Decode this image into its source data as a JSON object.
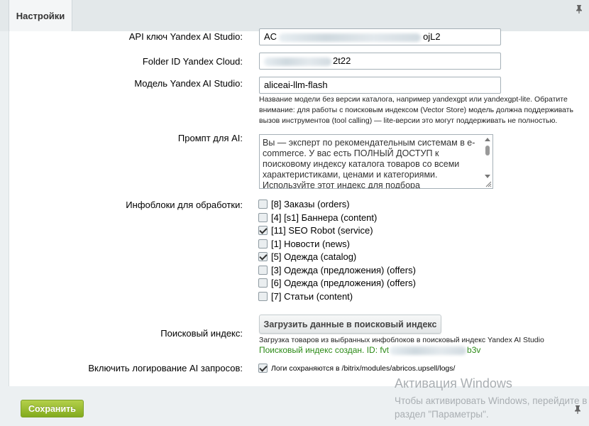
{
  "tabs": [
    {
      "label": "Настройки"
    }
  ],
  "form": {
    "api_key": {
      "label": "API ключ Yandex AI Studio:",
      "value_start": "AC",
      "value_end": "ojL2"
    },
    "folder_id": {
      "label": "Folder ID Yandex Cloud:",
      "value_end": "2t22"
    },
    "model": {
      "label": "Модель Yandex AI Studio:",
      "value": "aliceai-llm-flash",
      "hint": "Название модели без версии каталога, например yandexgpt или yandexgpt-lite. Обратите внимание: для работы с поисковым индексом (Vector Store) модель должна поддерживать вызов инструментов (tool calling) — lite-версии это могут поддерживать не полностью."
    },
    "prompt": {
      "label": "Промпт для AI:",
      "value": "Вы — эксперт по рекомендательным системам в e-commerce. У вас есть ПОЛНЫЙ ДОСТУП к поисковому индексу каталога товаров со всеми характеристиками, ценами и категориями. Используйте этот индекс для подбора рекомендаций."
    },
    "iblocks": {
      "label": "Инфоблоки для обработки:",
      "items": [
        {
          "label": "[8] Заказы (orders)",
          "checked": false
        },
        {
          "label": "[4] [s1] Баннера (content)",
          "checked": false
        },
        {
          "label": "[11] SEO Robot (service)",
          "checked": true
        },
        {
          "label": "[1] Новости (news)",
          "checked": false
        },
        {
          "label": "[5] Одежда (catalog)",
          "checked": true
        },
        {
          "label": "[3] Одежда (предложения) (offers)",
          "checked": false
        },
        {
          "label": "[6] Одежда (предложения) (offers)",
          "checked": false
        },
        {
          "label": "[7] Статьи (content)",
          "checked": false
        }
      ]
    },
    "search_index": {
      "label": "Поисковый индекс:",
      "button": "Загрузить данные в поисковый индекс",
      "hint": "Загрузка товаров из выбранных инфоблоков в поисковый индекс Yandex AI Studio",
      "status_prefix": "Поисковый индекс создан. ID: fvt",
      "status_suffix": "b3v"
    },
    "logging": {
      "label": "Включить логирование AI запросов:",
      "checked": true,
      "hint": "Логи сохраняются в /bitrix/modules/abricos.upsell/logs/"
    }
  },
  "footer": {
    "save_button": "Сохранить"
  },
  "watermark": {
    "title": "Активация Windows",
    "line1": "Чтобы активировать Windows, перейдите в",
    "line2": "раздел \"Параметры\"."
  },
  "colors": {
    "save": "#8bb327",
    "status": "#2b8a16"
  }
}
